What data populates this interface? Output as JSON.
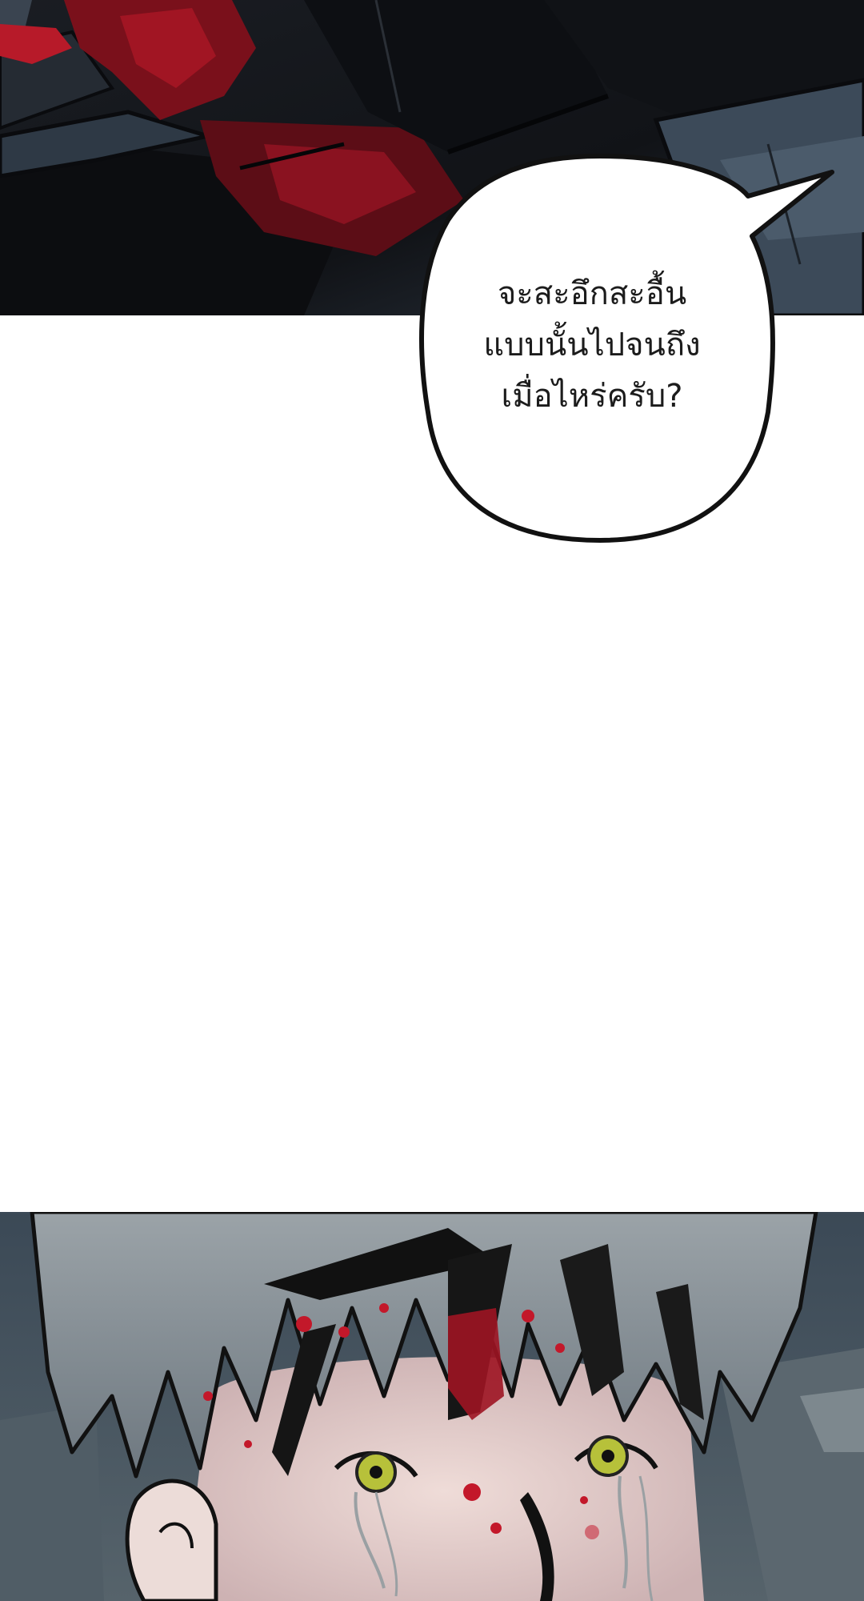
{
  "speech_bubble": {
    "lines": [
      "จะสะอึกสะอื้น",
      "แบบนั้นไปจนถึง",
      "เมื่อไหร่ครับ?"
    ]
  },
  "colors": {
    "panel_dark": "#16181d",
    "panel_slate": "#3d4a58",
    "blood_red": "#8b1420",
    "bright_red": "#c3182a",
    "skin": "#e8d2cf",
    "eye_green": "#b7c13a",
    "hair_gray": "#8b949b",
    "background": "#ffffff"
  }
}
